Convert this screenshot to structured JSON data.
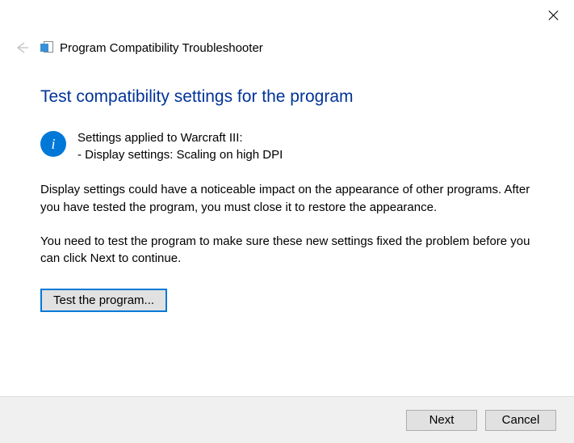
{
  "window": {
    "title": "Program Compatibility Troubleshooter"
  },
  "main": {
    "heading": "Test compatibility settings for the program",
    "info_line1": "Settings applied to Warcraft III:",
    "info_line2": "- Display settings:  Scaling on high DPI",
    "paragraph1": "Display settings could have a noticeable impact on the appearance of other programs. After you have tested the program, you must close it to restore the appearance.",
    "paragraph2": "You need to test the program to make sure these new settings fixed the problem before you can click Next to continue.",
    "test_button": "Test the program..."
  },
  "footer": {
    "next": "Next",
    "cancel": "Cancel"
  }
}
